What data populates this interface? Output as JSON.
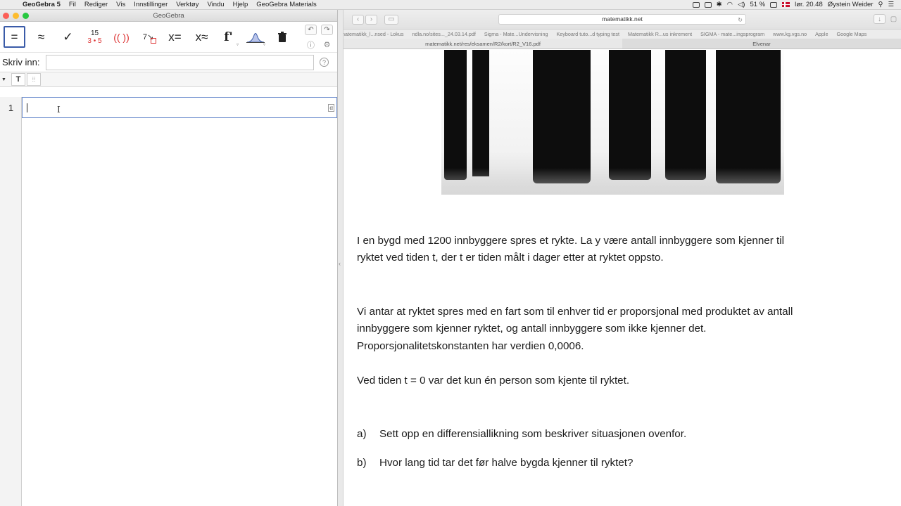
{
  "menubar": {
    "app_name": "GeoGebra 5",
    "items": [
      "Fil",
      "Rediger",
      "Vis",
      "Innstillinger",
      "Verktøy",
      "Vindu",
      "Hjelp",
      "GeoGebra Materials"
    ],
    "battery": "51 %",
    "clock": "lør. 20.48",
    "user": "Øystein Weider"
  },
  "geogebra": {
    "window_title": "GeoGebra",
    "tools": [
      {
        "name": "evaluate",
        "symbol": "="
      },
      {
        "name": "numeric",
        "symbol": "≈"
      },
      {
        "name": "keep-input",
        "symbol": "✓"
      },
      {
        "name": "factor",
        "top": "15",
        "bottom": "3 • 5"
      },
      {
        "name": "expand",
        "symbol": "(( ))"
      },
      {
        "name": "substitute",
        "symbol": "7↘"
      },
      {
        "name": "solve",
        "symbol": "x="
      },
      {
        "name": "solve-numerically",
        "symbol": "x≈"
      },
      {
        "name": "derivative",
        "symbol": "f'"
      },
      {
        "name": "probability",
        "symbol": "∧"
      },
      {
        "name": "delete",
        "symbol": "🗑"
      }
    ],
    "input_label": "Skriv inn:",
    "input_value": "",
    "help_symbol": "?",
    "cas_toolbar": {
      "text_button": "T",
      "grid_button": "⁞⁞"
    },
    "rows": [
      {
        "number": "1",
        "value": ""
      }
    ],
    "alpha_button": "α"
  },
  "browser": {
    "url": "matematikk.net",
    "bookmarks": [
      "natematikk_l...nsed - Lokus",
      "ndla.no/sites..._24.03.14.pdf",
      "Sigma - Mate...Undervisning",
      "Keyboard tuto...d typing test",
      "Matematikk R...us inkrement",
      "SIGMA - mate...ingsprogram",
      "www.kg.vgs.no",
      "Apple",
      "Google Maps"
    ],
    "tabs": [
      "matematikk.net/res/eksamen/R2/kort/R2_V16.pdf",
      "Elvenar"
    ]
  },
  "document": {
    "para1_line1": "I en bygd med 1200 innbyggere spres et rykte. La  y  være antall innbyggere som kjenner til",
    "para1_line2": "ryktet ved tiden  t, der  t  er tiden målt i dager etter at ryktet oppsto.",
    "para2_line1": "Vi antar at ryktet spres med en fart som til enhver tid er proporsjonal med produktet av antall",
    "para2_line2": "innbyggere som kjenner ryktet, og antall innbyggere som ikke kjenner det.",
    "para2_line3": "Proporsjonalitetskonstanten har verdien  0,0006.",
    "para3": "Ved tiden  t = 0  var det kun én person som kjente til ryktet.",
    "questions": [
      {
        "label": "a)",
        "text": "Sett opp en differensiallikning som beskriver situasjonen ovenfor."
      },
      {
        "label": "b)",
        "text": "Hvor lang tid tar det før halve bygda kjenner til ryktet?"
      }
    ]
  },
  "colors": {
    "accent": "#3a5ba8",
    "selected_border": "#6b8ccd",
    "red": "#d33333"
  }
}
